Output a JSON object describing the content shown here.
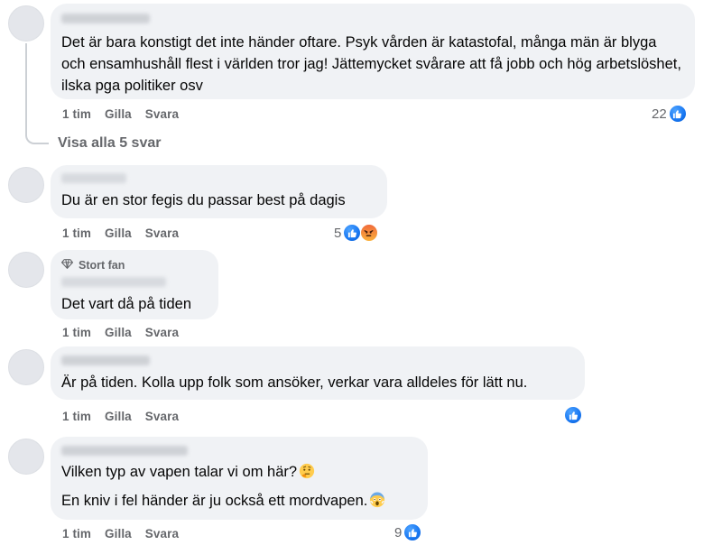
{
  "comments": [
    {
      "text_lines": [
        "Det är bara konstigt det inte händer oftare. Psyk vården är katastofal, många män är blyga och ensamhushåll flest i världen tror jag! Jättemycket svårare att få jobb och hög arbetslöshet, ilska pga politiker osv"
      ],
      "time": "1 tim",
      "like_label": "Gilla",
      "reply_label": "Svara",
      "reaction_count": "22",
      "reactions": [
        "like-icon"
      ]
    },
    {
      "text_lines": [
        "Du är en stor fegis du passar best på dagis"
      ],
      "time": "1 tim",
      "like_label": "Gilla",
      "reply_label": "Svara",
      "reaction_count": "5",
      "reactions": [
        "like-icon",
        "angry-icon"
      ]
    },
    {
      "badge": "Stort fan",
      "text_lines": [
        "Det vart då på tiden"
      ],
      "time": "1 tim",
      "like_label": "Gilla",
      "reply_label": "Svara",
      "reaction_count": "",
      "reactions": []
    },
    {
      "text_lines": [
        "Är på tiden. Kolla upp folk som ansöker, verkar vara alldeles för lätt nu."
      ],
      "time": "1 tim",
      "like_label": "Gilla",
      "reply_label": "Svara",
      "reaction_count": "",
      "reactions": [
        "like-icon"
      ]
    },
    {
      "text_lines": [
        "Vilken typ av vapen talar vi om här?",
        "En kniv i fel händer är ju också ett mordvapen."
      ],
      "emojis": [
        "thinking-face-icon",
        "screaming-face-icon"
      ],
      "time": "1 tim",
      "like_label": "Gilla",
      "reply_label": "Svara",
      "reaction_count": "9",
      "reactions": [
        "like-icon"
      ]
    }
  ],
  "show_replies": "Visa alla 5 svar",
  "colors": {
    "bubble": "#f0f2f5",
    "secondary_text": "#65676b",
    "like_blue": "#1877f2"
  }
}
